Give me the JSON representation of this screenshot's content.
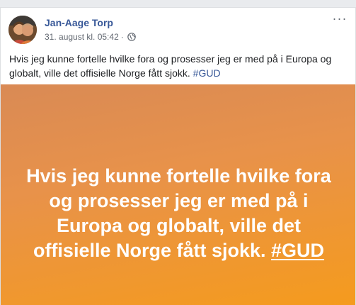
{
  "post": {
    "author": "Jan-Aage Torp",
    "date": "31. august kl. 05:42",
    "separator": "·",
    "privacy_icon": "globe-icon",
    "more_icon": "more-options-icon",
    "more_label": "···",
    "text_main": "Hvis jeg kunne fortelle hvilke fora og prosesser jeg er med på i Europa og globalt, ville det offisielle Norge fått sjokk. ",
    "text_hashtag": "#GUD",
    "background_text_main": "Hvis jeg kunne fortelle hvilke fora og prosesser jeg er med på i Europa og globalt, ville det offisielle Norge fått sjokk. ",
    "background_text_hashtag": "#GUD"
  },
  "colors": {
    "page_background": "#e9ebee",
    "author_link": "#385898",
    "meta_text": "#616770",
    "body_text": "#1c1e21",
    "background_gradient_start": "#d98a55",
    "background_gradient_end": "#f59b1d",
    "background_text": "#ffffff"
  }
}
